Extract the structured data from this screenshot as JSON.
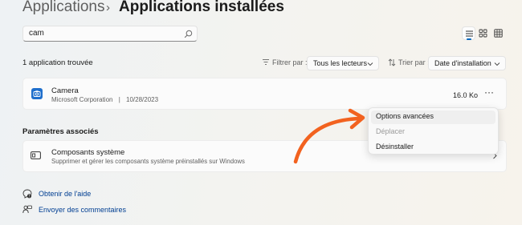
{
  "breadcrumb": {
    "parent": "Applications",
    "separator": "›",
    "current": "Applications installées"
  },
  "search": {
    "value": "cam",
    "icon": "search-icon"
  },
  "view_modes": [
    "list-view-icon",
    "grid-view-icon",
    "table-view-icon"
  ],
  "results": {
    "count_text": "1 application trouvée"
  },
  "filter": {
    "label": "Filtrer par :",
    "value": "Tous les lecteurs"
  },
  "sort": {
    "label": "Trier par :",
    "value": "Date d'installation"
  },
  "app": {
    "name": "Camera",
    "publisher": "Microsoft Corporation",
    "separator": "|",
    "date": "10/28/2023",
    "size": "16.0 Ko",
    "more": "···"
  },
  "context_menu": {
    "items": [
      {
        "label": "Options avancées",
        "enabled": true
      },
      {
        "label": "Déplacer",
        "enabled": false
      },
      {
        "label": "Désinstaller",
        "enabled": true
      }
    ]
  },
  "related": {
    "title": "Paramètres associés",
    "items": [
      {
        "title": "Composants système",
        "description": "Supprimer et gérer les composants système préinstallés sur Windows"
      }
    ]
  },
  "links": [
    {
      "label": "Obtenir de l'aide",
      "icon": "help-icon"
    },
    {
      "label": "Envoyer des commentaires",
      "icon": "feedback-icon"
    }
  ],
  "colors": {
    "accent": "#0067c0",
    "annotation_arrow": "#f2621f",
    "link": "#003e92"
  }
}
